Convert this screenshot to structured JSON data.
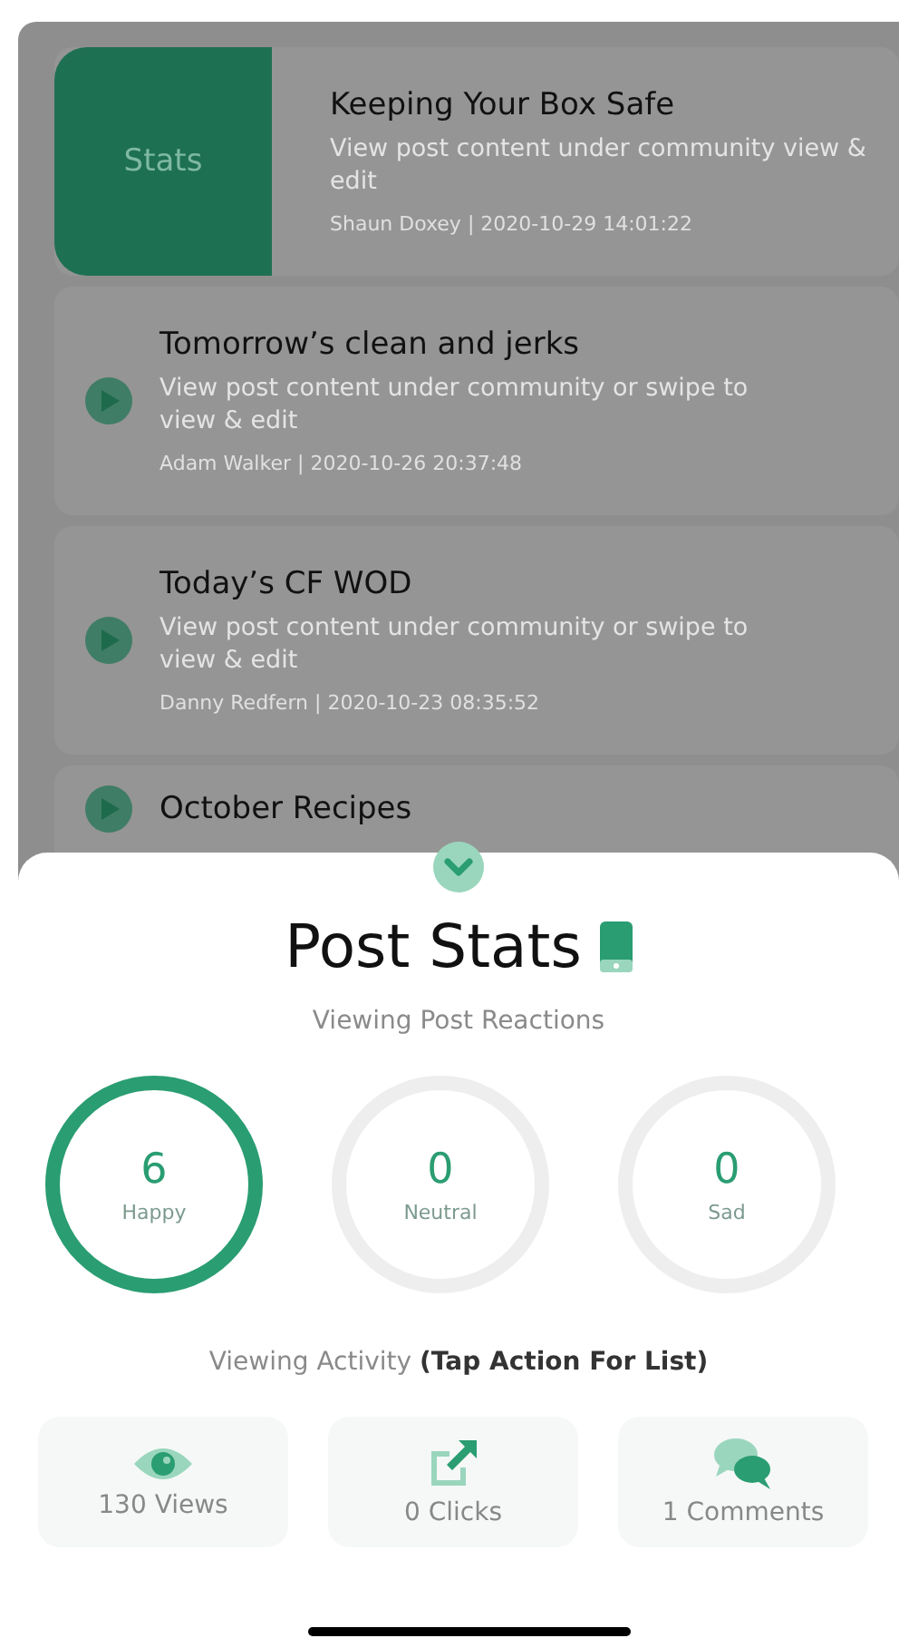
{
  "posts": [
    {
      "title": "Keeping Your Box Safe",
      "description": "View post content under community view & edit",
      "meta": "Shaun Doxey | 2020-10-29 14:01:22",
      "swipe_action": "Stats",
      "swiped": true
    },
    {
      "title": "Tomorrow’s clean and jerks",
      "description": "View post content under community or swipe to view & edit",
      "meta": "Adam Walker | 2020-10-26 20:37:48",
      "swiped": false
    },
    {
      "title": "Today’s CF WOD",
      "description": "View post content under community or swipe to view & edit",
      "meta": "Danny Redfern | 2020-10-23 08:35:52",
      "swiped": false
    },
    {
      "title": "October Recipes",
      "swiped": false
    }
  ],
  "sheet": {
    "title": "Post Stats",
    "subtitle": "Viewing Post Reactions",
    "reactions": [
      {
        "count": "6",
        "label": "Happy",
        "highlighted": true
      },
      {
        "count": "0",
        "label": "Neutral",
        "highlighted": false
      },
      {
        "count": "0",
        "label": "Sad",
        "highlighted": false
      }
    ],
    "activity_heading": "Viewing Activity **(Tap Action For List)**",
    "activity": [
      {
        "kind": "views",
        "label": "130 Views"
      },
      {
        "kind": "clicks",
        "label": "0 Clicks"
      },
      {
        "kind": "comments",
        "label": "1 Comments"
      }
    ]
  }
}
